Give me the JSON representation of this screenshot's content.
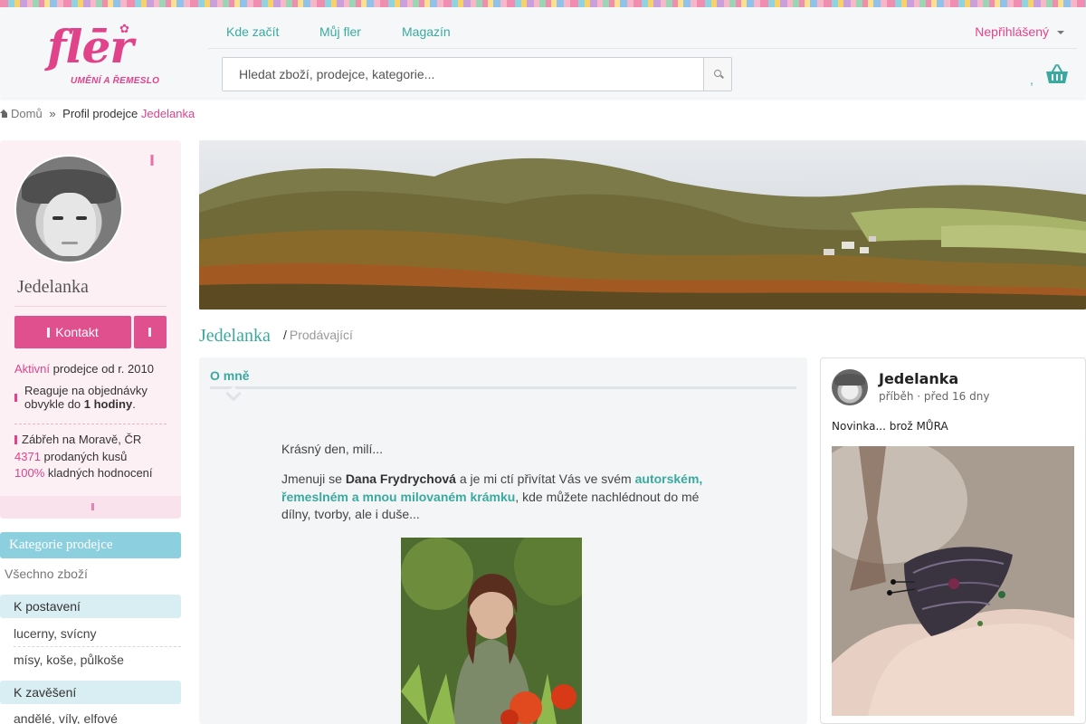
{
  "header": {
    "logo_word": "flēr",
    "logo_tagline": "UMĚNÍ A ŘEMESLO",
    "nav": [
      "Kde začít",
      "Můj fler",
      "Magazín"
    ],
    "user_menu": "Nepřihlášený",
    "search_placeholder": "Hledat zboží, prodejce, kategorie...",
    "cart_count": ","
  },
  "breadcrumb": {
    "home": "Domů",
    "separator": "»",
    "section": "Profil prodejce",
    "seller": "Jedelanka"
  },
  "profile": {
    "name": "Jedelanka",
    "contact_label": "Kontakt",
    "active_word": "Aktivní",
    "since_text": "prodejce od r. 2010",
    "response_line1": "Reaguje na objednávky",
    "response_prefix": "obvykle do ",
    "response_time": "1 hodiny",
    "response_suffix": ".",
    "location": "Zábřeh na Moravě, ČR",
    "sold_count": "4371",
    "sold_label": "prodaných kusů",
    "rating_percent": "100%",
    "rating_label": "kladných hodnocení"
  },
  "categories": {
    "title": "Kategorie prodejce",
    "all": "Všechno zboží",
    "groups": [
      {
        "label": "K postavení",
        "items": [
          "lucerny, svícny",
          "mísy, koše, půlkoše"
        ]
      },
      {
        "label": "K zavěšení",
        "items": [
          "andělé, víly, elfové"
        ]
      }
    ]
  },
  "shop": {
    "title": "Jedelanka",
    "slash": "/",
    "role": "Prodávající"
  },
  "about": {
    "title": "O mně",
    "greeting": "Krásný den, milí...",
    "intro_prefix": "Jmenuji se ",
    "intro_name": "Dana Frydrychová",
    "intro_mid": " a je mi ctí přivítat Vás ve svém ",
    "intro_highlight_1": "autorském,",
    "intro_highlight_2": "řemeslném a mnou milovaném krámku",
    "intro_suffix_1": ", kde můžete nachlédnout do mé",
    "intro_suffix_2": "dílny, tvorby, ale i duše..."
  },
  "story": {
    "author": "Jedelanka",
    "meta": "příběh · před 16 dny",
    "text": "Novinka... brož MŮRA"
  },
  "colors": {
    "brand_pink": "#e0438a",
    "teal": "#3aa9a0",
    "category_blue": "#8ccfdf"
  },
  "icons": {
    "search": "search-icon",
    "cart": "basket-icon",
    "favorite": "heart-icon",
    "home": "home-icon"
  }
}
